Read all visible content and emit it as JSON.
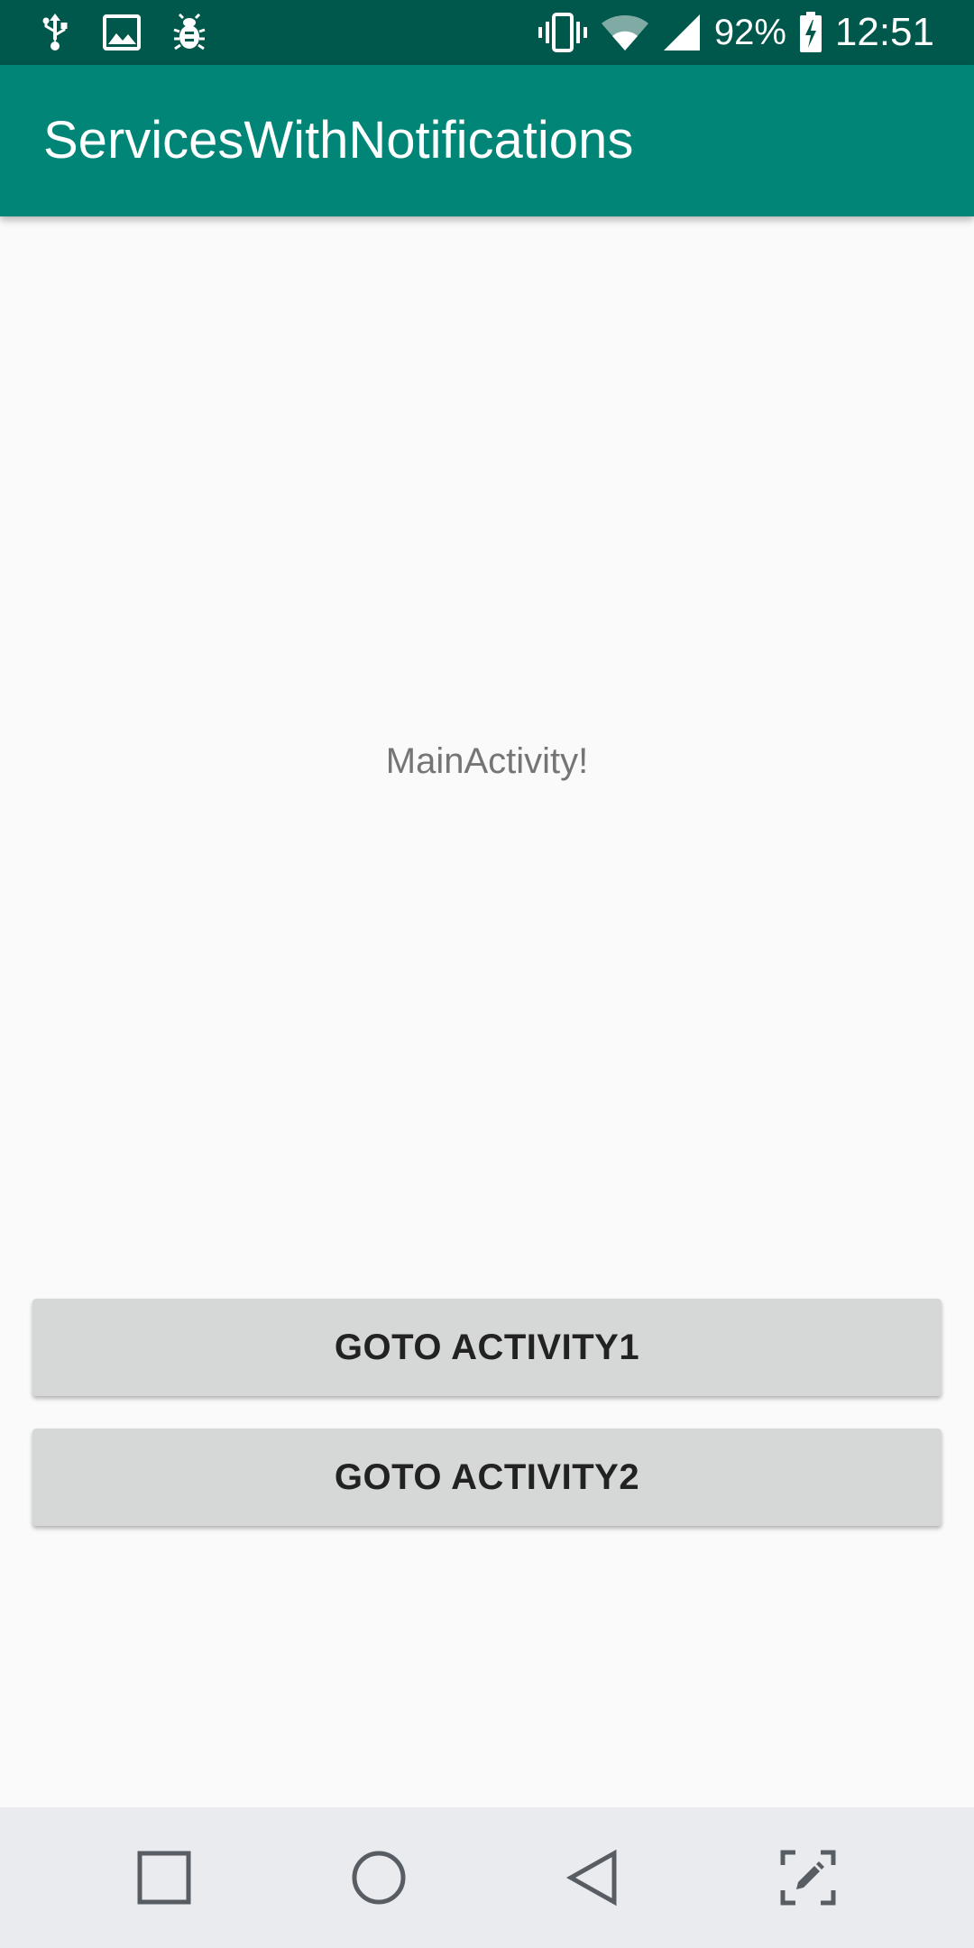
{
  "status_bar": {
    "left_icons": [
      "usb-icon",
      "image-icon",
      "bug-icon"
    ],
    "right_icons": [
      "vibrate-icon",
      "wifi-icon",
      "signal-icon",
      "battery-icon"
    ],
    "battery_percent": "92%",
    "time": "12:51"
  },
  "app_bar": {
    "title": "ServicesWithNotifications"
  },
  "main": {
    "label": "MainActivity!",
    "button1_label": "GOTO ACTIVITY1",
    "button2_label": "GOTO ACTIVITY2"
  },
  "nav_bar": {
    "icons": [
      "recents-square-icon",
      "home-circle-icon",
      "back-triangle-icon",
      "screenshot-edit-icon"
    ]
  },
  "colors": {
    "status_bar": "#00574b",
    "app_bar": "#008577",
    "background": "#fafafa",
    "button": "#d6d7d7",
    "nav_bar": "#eaebee"
  }
}
